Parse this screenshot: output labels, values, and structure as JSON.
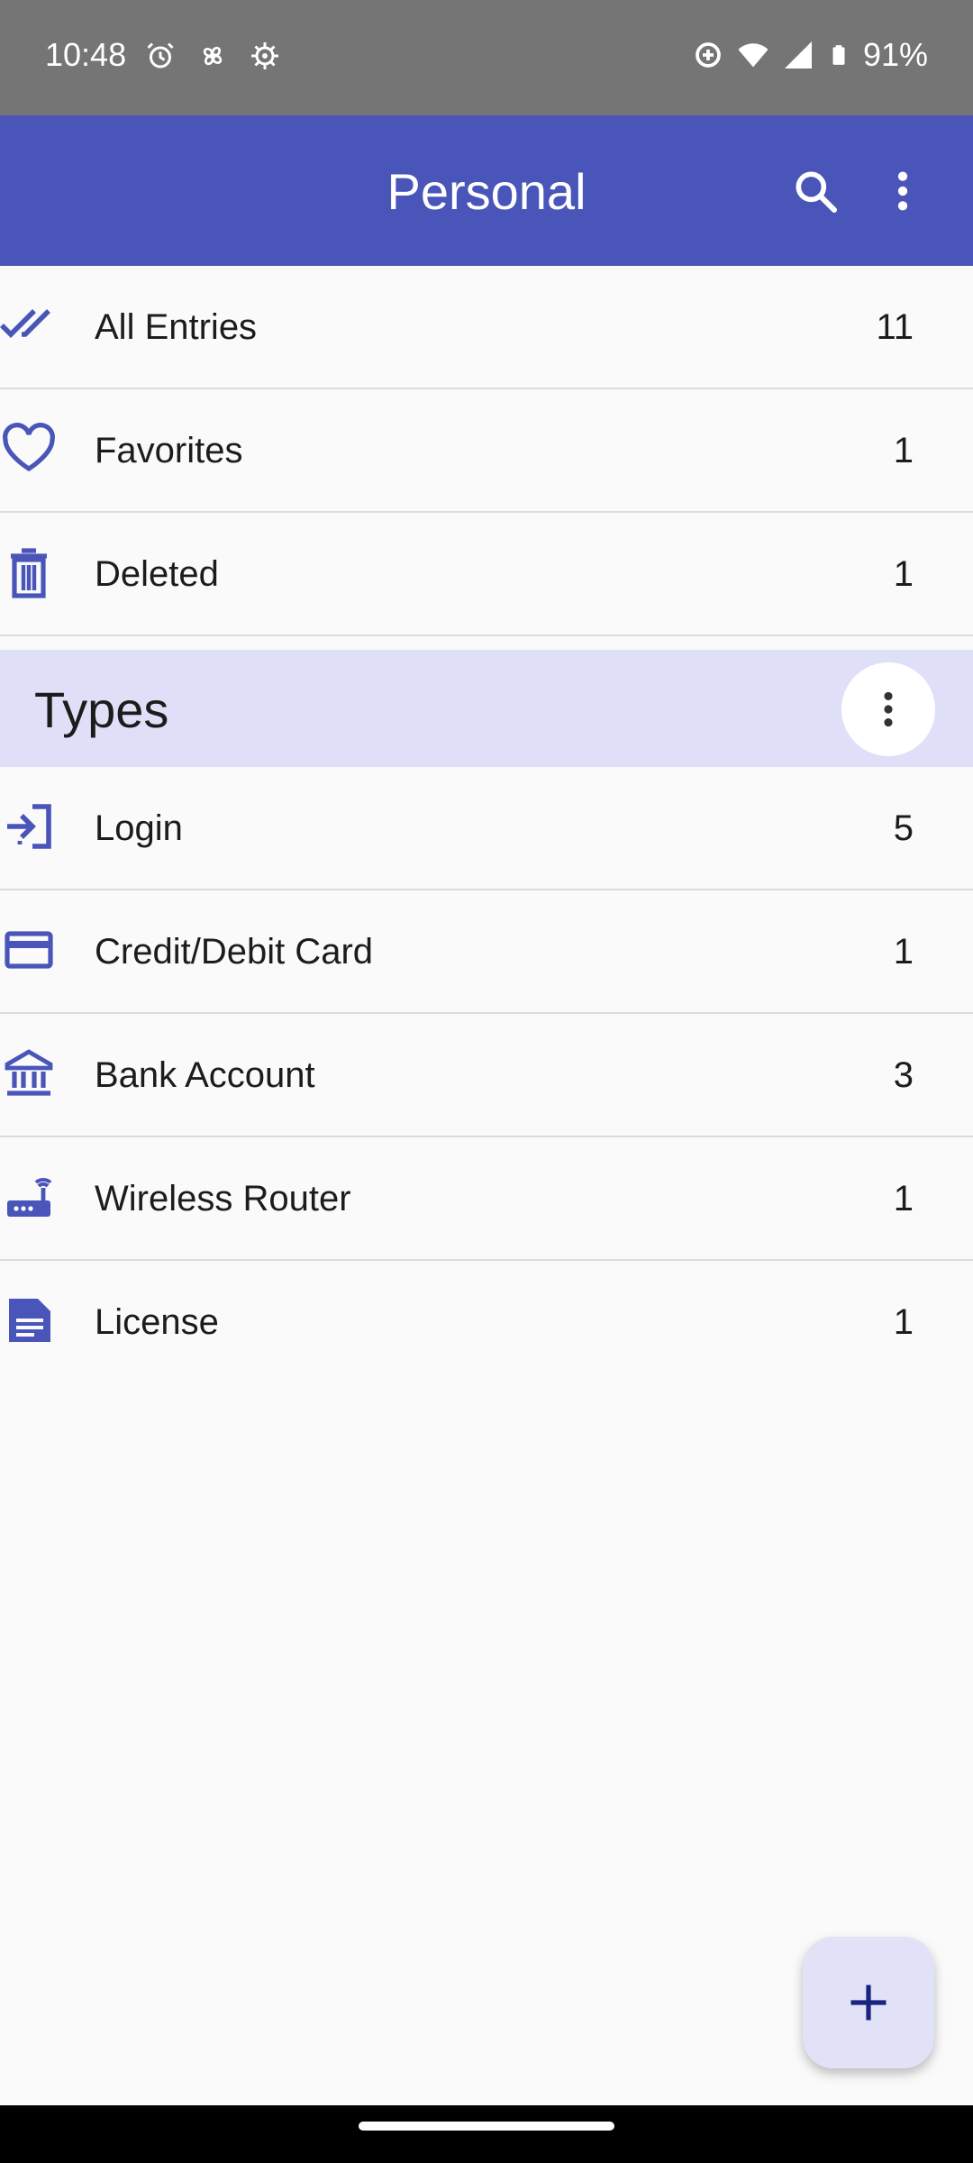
{
  "status_bar": {
    "time": "10:48",
    "battery": "91%",
    "left_icons": [
      "alarm-icon",
      "fan-icon",
      "settings-gear-icon"
    ],
    "right_icons": [
      "data-saver-icon",
      "wifi-icon",
      "signal-icon",
      "battery-icon"
    ]
  },
  "app_bar": {
    "title": "Personal",
    "actions": [
      "search-icon",
      "more-vert-icon"
    ]
  },
  "categories": [
    {
      "label": "All Entries",
      "count": "11",
      "icon": "double-check-icon"
    },
    {
      "label": "Favorites",
      "count": "1",
      "icon": "heart-icon"
    },
    {
      "label": "Deleted",
      "count": "1",
      "icon": "trash-icon"
    }
  ],
  "types_section": {
    "title": "Types",
    "items": [
      {
        "label": "Login",
        "count": "5",
        "icon": "login-icon"
      },
      {
        "label": "Credit/Debit Card",
        "count": "1",
        "icon": "credit-card-icon"
      },
      {
        "label": "Bank Account",
        "count": "3",
        "icon": "bank-icon"
      },
      {
        "label": "Wireless Router",
        "count": "1",
        "icon": "router-icon"
      },
      {
        "label": "License",
        "count": "1",
        "icon": "license-icon"
      }
    ]
  },
  "fab": {
    "icon": "plus-icon"
  },
  "colors": {
    "primary": "#4a55b9",
    "icon_accent": "#4a55b9",
    "section_bg": "#dfe0f8",
    "fab_bg": "#e1e2f8",
    "status_bar": "#757575"
  }
}
